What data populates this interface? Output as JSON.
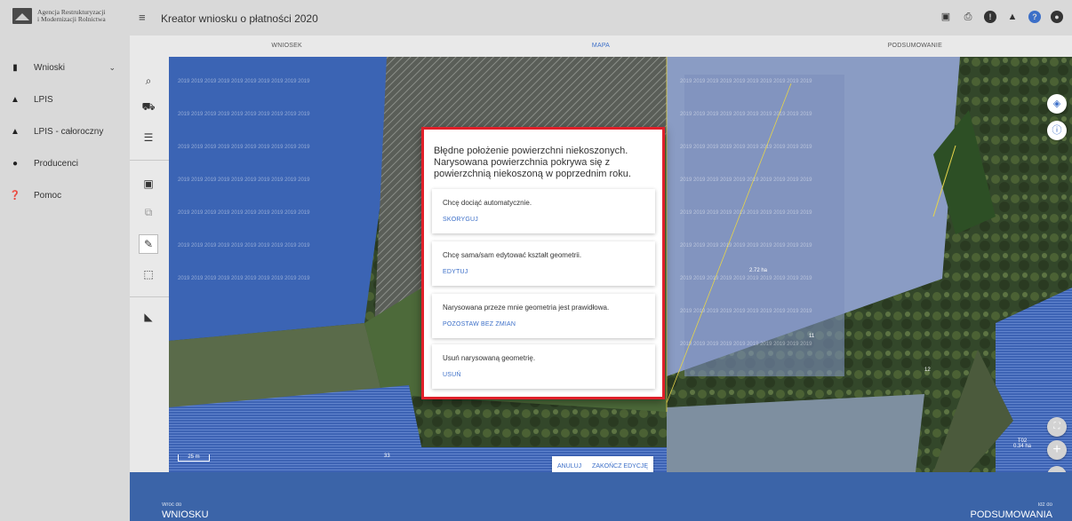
{
  "logo": {
    "line1": "Agencja Restrukturyzacji",
    "line2": "i Modernizacji Rolnictwa",
    "icon": "arimr-logo-icon"
  },
  "sidebar": {
    "items": [
      {
        "label": "Wnioski",
        "icon": "document-icon",
        "has_chevron": true
      },
      {
        "label": "LPIS",
        "icon": "mountain-icon"
      },
      {
        "label": "LPIS - całoroczny",
        "icon": "mountain-icon"
      },
      {
        "label": "Producenci",
        "icon": "person-icon"
      },
      {
        "label": "Pomoc",
        "icon": "help-icon"
      }
    ],
    "chevron": "⌄"
  },
  "header": {
    "title": "Kreator wniosku o płatności 2020",
    "icons": [
      "save-icon",
      "print-icon",
      "info-icon",
      "bell-icon",
      "help-icon",
      "account-icon"
    ]
  },
  "tabs": [
    {
      "label": "WNIOSEK",
      "active": false
    },
    {
      "label": "MAPA",
      "active": true
    },
    {
      "label": "PODSUMOWANIE",
      "active": false
    }
  ],
  "tools": [
    "search-icon",
    "tractor-icon",
    "list-icon",
    "select-icon",
    "copy-icon",
    "pencil-icon",
    "bounding-box-icon",
    "measure-icon"
  ],
  "map": {
    "area_label": "2.72 ha",
    "parcel_label_1": "T02",
    "parcel_label_2": "0.34 ha",
    "parcel_number_1": "12",
    "parcel_number_2": "11",
    "parcel_number_3": "33",
    "year_pattern": "2019 2019 2019 2019 2019 2019 2019 2019 2019 2019",
    "scale_label": "25 m",
    "edit_cancel": "ANULUJ",
    "edit_finish": "ZAKOŃCZ EDYCJĘ",
    "controls": [
      "layers-icon",
      "info-icon",
      "fullscreen-icon",
      "zoom-in-icon",
      "zoom-out-icon"
    ]
  },
  "modal": {
    "title": "Błędne położenie powierzchni niekoszonych. Narysowana powierzchnia pokrywa się z powierzchnią niekoszoną w poprzednim roku.",
    "options": [
      {
        "text": "Chcę dociąć automatycznie.",
        "button": "SKORYGUJ"
      },
      {
        "text": "Chcę sama/sam edytować kształt geometrii.",
        "button": "EDYTUJ"
      },
      {
        "text": "Narysowana przeze mnie geometria jest prawidłowa.",
        "button": "POZOSTAW BEZ ZMIAN"
      },
      {
        "text": "Usuń narysowaną geometrię.",
        "button": "USUŃ"
      }
    ]
  },
  "footer": {
    "back_small": "Wróć do",
    "back_big": "WNIOSKU",
    "next_small": "Idź do",
    "next_big": "PODSUMOWANIA"
  },
  "colors": {
    "accent": "#3c6fc8",
    "modal_border": "#e0202a",
    "footer": "#3b64a8"
  }
}
